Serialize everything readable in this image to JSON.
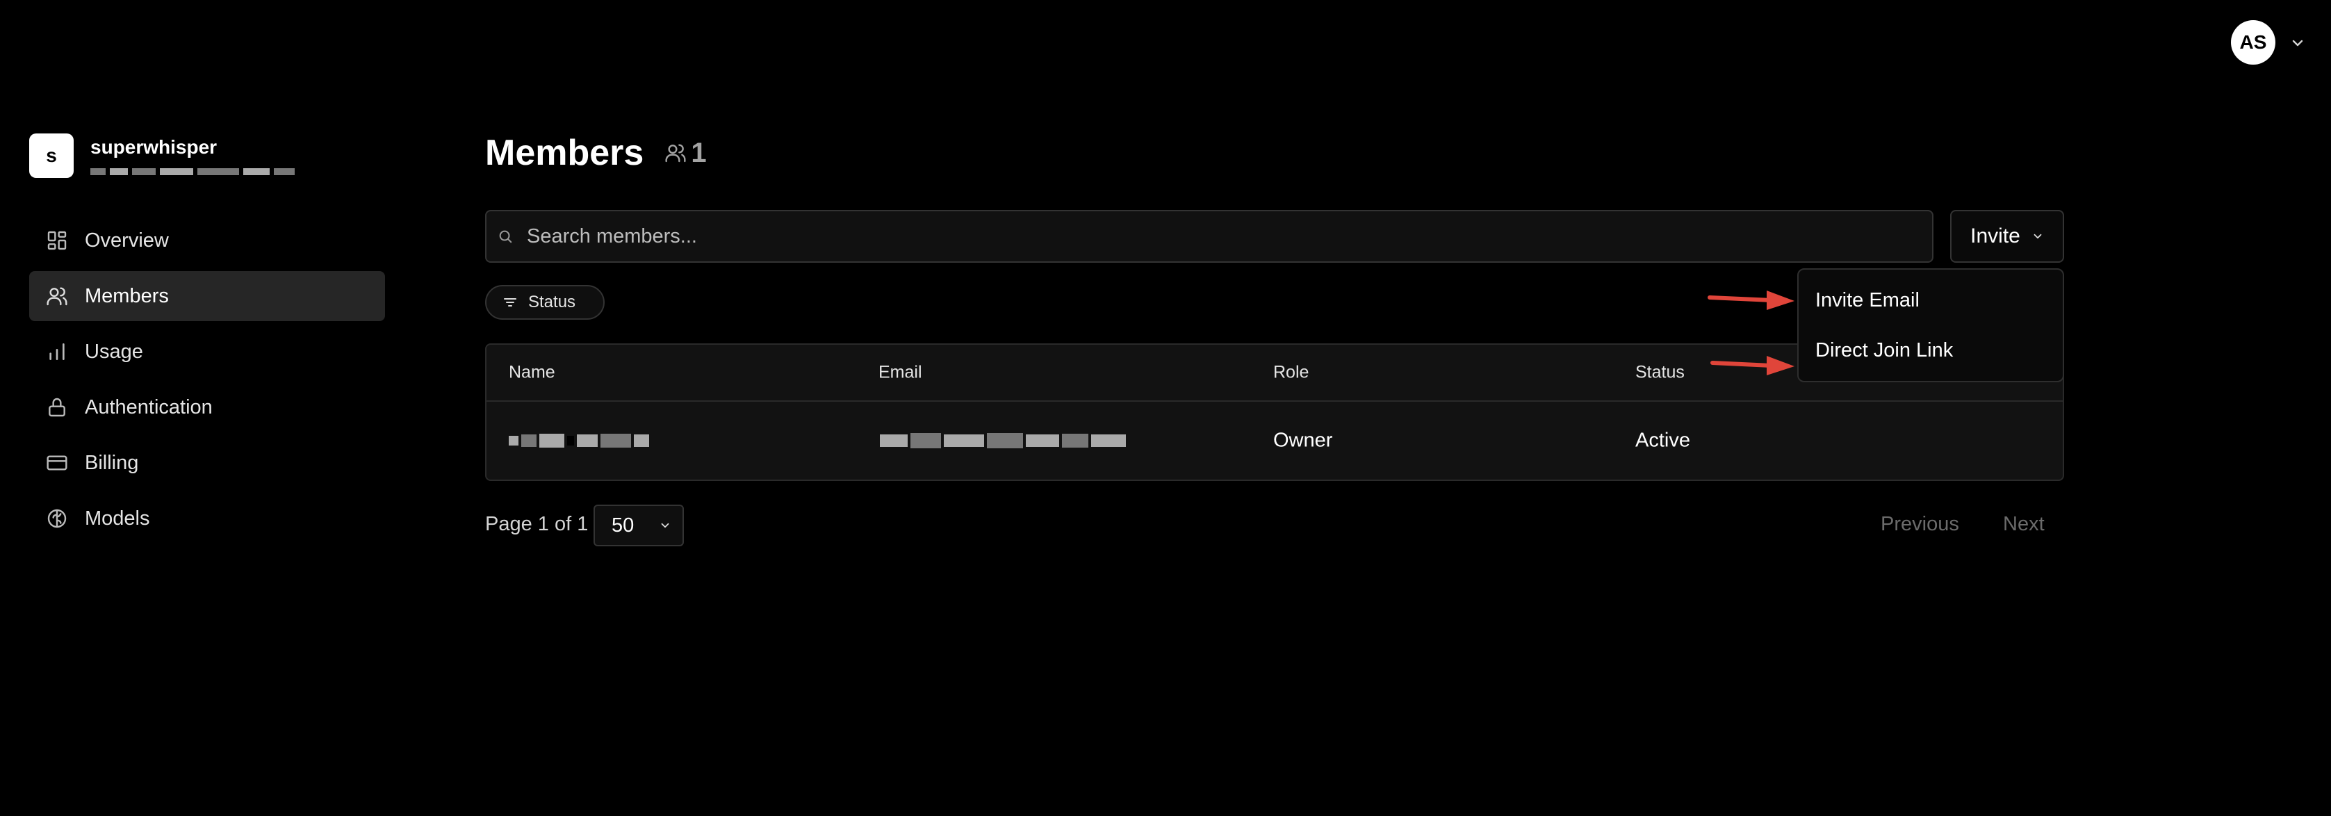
{
  "user": {
    "initials": "AS"
  },
  "org": {
    "logo_letter": "s",
    "name": "superwhisper"
  },
  "nav": [
    {
      "label": "Overview",
      "icon": "grid-icon",
      "active": false
    },
    {
      "label": "Members",
      "icon": "users-icon",
      "active": true
    },
    {
      "label": "Usage",
      "icon": "bar-chart-icon",
      "active": false
    },
    {
      "label": "Authentication",
      "icon": "lock-icon",
      "active": false
    },
    {
      "label": "Billing",
      "icon": "credit-card-icon",
      "active": false
    },
    {
      "label": "Models",
      "icon": "brain-icon",
      "active": false
    }
  ],
  "page": {
    "title": "Members",
    "member_count": "1"
  },
  "search": {
    "placeholder": "Search members..."
  },
  "invite": {
    "label": "Invite"
  },
  "filter": {
    "label": "Status"
  },
  "table": {
    "columns": [
      "Name",
      "Email",
      "Role",
      "Status"
    ],
    "rows": [
      {
        "name": "",
        "email": "",
        "role": "Owner",
        "status": "Active"
      }
    ]
  },
  "pagination": {
    "label": "Page 1 of 1",
    "page_size": "50",
    "previous": "Previous",
    "next": "Next"
  },
  "invite_menu": {
    "items": [
      "Invite Email",
      "Direct Join Link"
    ]
  },
  "colors": {
    "background": "#000000",
    "active_nav": "#262626",
    "annotation_arrow": "#e0453a"
  }
}
